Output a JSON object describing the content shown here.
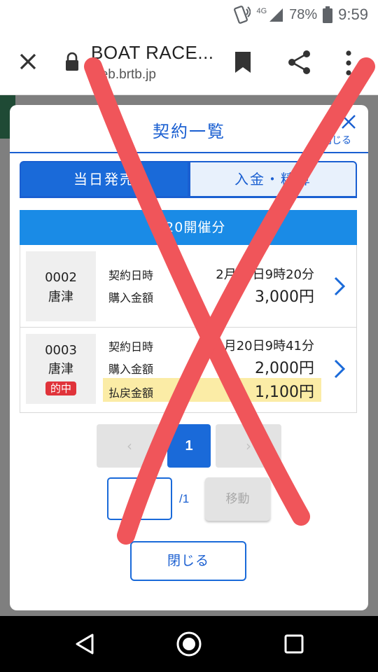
{
  "status_bar": {
    "network": "4G",
    "battery": "78%",
    "time": "9:59",
    "icons": [
      "vibrate-icon",
      "signal-icon",
      "battery-icon"
    ]
  },
  "browser": {
    "title": "BOAT RACE...",
    "url": "web.brtb.jp",
    "icons": [
      "close-icon",
      "lock-icon",
      "bookmark-icon",
      "share-icon",
      "more-vert-icon"
    ]
  },
  "modal": {
    "title": "契約一覧",
    "close_label": "閉じる",
    "close_icon": "close-icon",
    "tabs": [
      {
        "label": "当日発売",
        "active": true
      },
      {
        "label": "入金・精算",
        "active": false
      }
    ],
    "date_header": "2/20開催分",
    "contracts": [
      {
        "number": "0002",
        "venue": "唐津",
        "hit": false,
        "date_label": "契約日時",
        "date": "2月20日9時20分",
        "amount_label": "購入金額",
        "amount": "3,000円"
      },
      {
        "number": "0003",
        "venue": "唐津",
        "hit": true,
        "hit_label": "的中",
        "date_label": "契約日時",
        "date": "2月20日9時41分",
        "amount_label": "購入金額",
        "amount": "2,000円",
        "payout_label": "払戻金額",
        "payout": "1,100円"
      }
    ],
    "pagination": {
      "prev": "‹",
      "current": "1",
      "next": "›",
      "input_value": "",
      "total": "/1",
      "move_label": "移動"
    },
    "close_button": "閉じる"
  },
  "colors": {
    "accent": "#1a6ad9",
    "date_bar": "#1a8be6",
    "hit_badge": "#e0333a",
    "payout_band": "#fbeca6",
    "overlay_x": "#f0555a"
  }
}
